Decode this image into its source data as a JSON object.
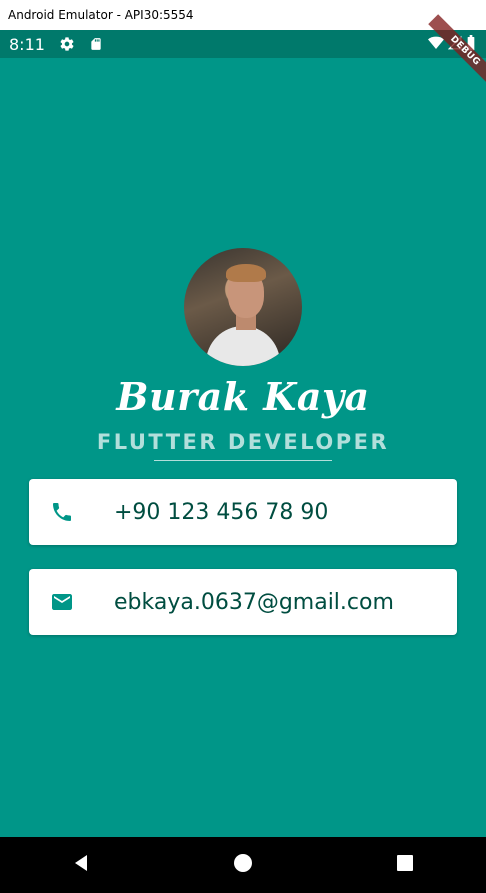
{
  "window": {
    "title": "Android Emulator - API30:5554"
  },
  "status_bar": {
    "time": "8:11",
    "left_icons": [
      "settings-icon",
      "sd-card-icon"
    ],
    "right_icons": [
      "wifi-icon",
      "signal-icon",
      "battery-icon"
    ],
    "background": "#00796b"
  },
  "debug_banner": {
    "label": "DEBUG"
  },
  "profile": {
    "name": "Burak Kaya",
    "title": "FLUTTER DEVELOPER",
    "background": "#009688"
  },
  "contacts": [
    {
      "icon": "phone-icon",
      "text": "+90 123 456 78 90"
    },
    {
      "icon": "mail-icon",
      "text": "ebkaya.0637@gmail.com"
    }
  ],
  "nav_bar": {
    "buttons": [
      "back-icon",
      "home-icon",
      "recents-icon"
    ]
  }
}
